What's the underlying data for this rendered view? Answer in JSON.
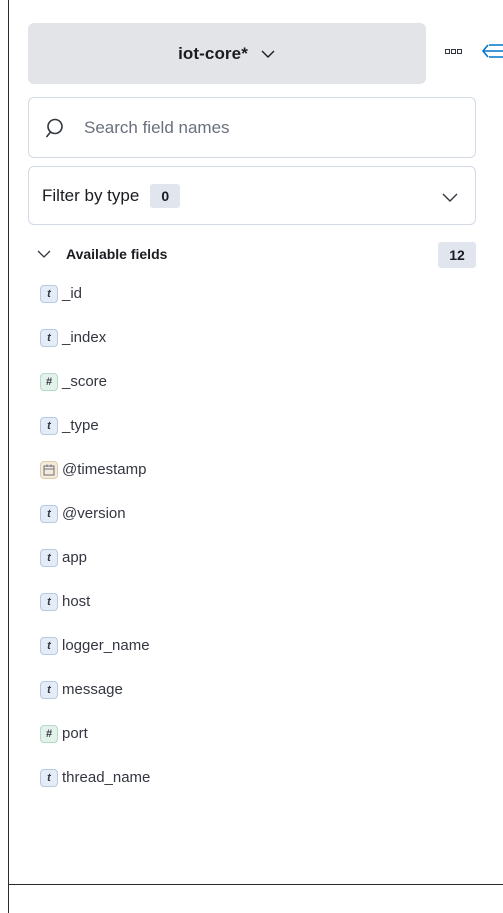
{
  "index_pattern": {
    "label": "iot-core*"
  },
  "search": {
    "placeholder": "Search field names",
    "value": ""
  },
  "filter": {
    "label": "Filter by type",
    "count": "0"
  },
  "available_fields": {
    "title": "Available fields",
    "count": "12",
    "items": [
      {
        "name": "_id",
        "type": "string",
        "token": "t"
      },
      {
        "name": "_index",
        "type": "string",
        "token": "t"
      },
      {
        "name": "_score",
        "type": "number",
        "token": "#"
      },
      {
        "name": "_type",
        "type": "string",
        "token": "t"
      },
      {
        "name": "@timestamp",
        "type": "date",
        "token": "calendar-icon"
      },
      {
        "name": "@version",
        "type": "string",
        "token": "t"
      },
      {
        "name": "app",
        "type": "string",
        "token": "t"
      },
      {
        "name": "host",
        "type": "string",
        "token": "t"
      },
      {
        "name": "logger_name",
        "type": "string",
        "token": "t"
      },
      {
        "name": "message",
        "type": "string",
        "token": "t"
      },
      {
        "name": "port",
        "type": "number",
        "token": "#"
      },
      {
        "name": "thread_name",
        "type": "string",
        "token": "t"
      }
    ]
  },
  "icons": {
    "index_chevron": "chevron-down-icon",
    "options": "options-icon",
    "collapse": "collapse-sidebar-icon",
    "search": "search-icon",
    "filter_chevron": "chevron-down-icon",
    "section_chevron": "chevron-down-icon"
  },
  "colors": {
    "accent": "#0077cc",
    "picker_bg": "#e2e4e8",
    "badge_bg": "#e0e5ee"
  }
}
